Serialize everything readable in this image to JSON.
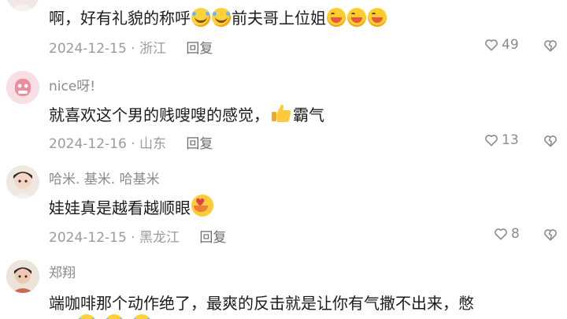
{
  "comments": [
    {
      "text": "啊，好有礼貌的称呼",
      "text_tail": "前夫哥上位姐",
      "date": "2024-12-15",
      "location": "浙江",
      "reply_label": "回复",
      "likes": "49"
    },
    {
      "username": "nice呀!",
      "text": "就喜欢这个男的贱嗖嗖的感觉，",
      "text_tail": "霸气",
      "date": "2024-12-16",
      "location": "山东",
      "reply_label": "回复",
      "likes": "13"
    },
    {
      "username": "哈米. 基米. 哈基米",
      "text": "娃娃真是越看越顺眼",
      "date": "2024-12-15",
      "location": "黑龙江",
      "reply_label": "回复",
      "likes": "8"
    },
    {
      "username": "郑翔",
      "text": "端咖啡那个动作绝了，最爽的反击就是让你有气撒不出来，憋"
    }
  ],
  "icons": {
    "like": "heart-outline-icon",
    "dislike": "heart-broken-outline-icon"
  }
}
